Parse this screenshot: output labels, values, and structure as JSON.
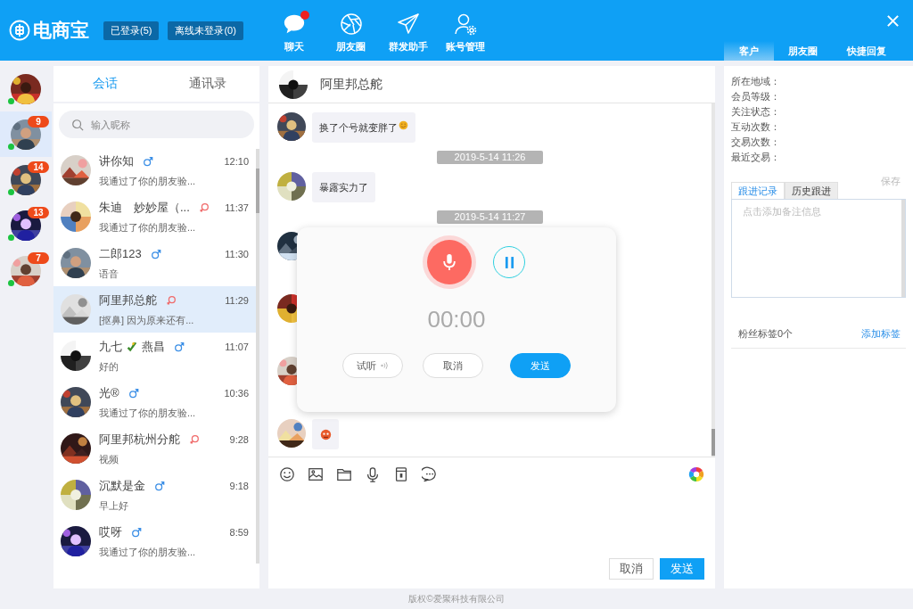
{
  "header": {
    "logo": "电商宝",
    "status_buttons": [
      {
        "label": "已登录(5)"
      },
      {
        "label": "离线未登录(0)"
      }
    ],
    "nav": [
      {
        "label": "聊天",
        "dot": true
      },
      {
        "label": "朋友圈",
        "dot": false
      },
      {
        "label": "群发助手",
        "dot": false
      },
      {
        "label": "账号管理",
        "dot": false
      }
    ],
    "right_tabs": [
      {
        "label": "客户",
        "selected": true
      },
      {
        "label": "朋友圈",
        "selected": false
      },
      {
        "label": "快捷回复",
        "selected": false
      }
    ]
  },
  "accounts": [
    {
      "online": true,
      "selected": false
    },
    {
      "badge": "9",
      "online": true,
      "selected": true
    },
    {
      "badge": "14",
      "online": true,
      "selected": false
    },
    {
      "badge": "13",
      "online": true,
      "selected": false
    },
    {
      "badge": "7",
      "online": true,
      "selected": false
    }
  ],
  "conversations": {
    "tabs": [
      {
        "label": "会话",
        "selected": true
      },
      {
        "label": "通讯录",
        "selected": false
      }
    ],
    "search": {
      "placeholder": "输入昵称"
    },
    "items": [
      {
        "name": "讲你知",
        "kind": "male",
        "time": "12:10",
        "preview": "我通过了你的朋友验...",
        "selected": false
      },
      {
        "name": "朱迪　妙妙屋（...",
        "kind": "female",
        "time": "11:37",
        "preview": "我通过了你的朋友验...",
        "selected": false
      },
      {
        "name": "二郎123",
        "kind": "male",
        "time": "11:30",
        "preview": "语音",
        "selected": false
      },
      {
        "name": "阿里邦总舵",
        "kind": "female",
        "time": "11:29",
        "preview": "[抠鼻] 因为原来还有...",
        "selected": true
      },
      {
        "name": "九七",
        "name_after_icon": "燕昌",
        "kind": "male",
        "time": "11:07",
        "preview": "好的",
        "selected": false
      },
      {
        "name": "光®",
        "kind": "male",
        "time": "10:36",
        "preview": "我通过了你的朋友验...",
        "selected": false
      },
      {
        "name": "阿里邦杭州分舵",
        "kind": "female",
        "time": "9:28",
        "preview": "视频",
        "selected": false
      },
      {
        "name": "沉默是金",
        "kind": "male",
        "time": "9:18",
        "preview": "早上好",
        "selected": false
      },
      {
        "name": "哎呀",
        "kind": "male",
        "time": "8:59",
        "preview": "我通过了你的朋友验...",
        "selected": false
      }
    ]
  },
  "chat": {
    "title": "阿里邦总舵",
    "messages": [
      {
        "kind": "text",
        "text": "换了个号就变胖了",
        "emoji": true
      },
      {
        "kind": "time",
        "text": "2019-5-14 11:26"
      },
      {
        "kind": "text",
        "text": "暴露实力了",
        "emoji": false
      },
      {
        "kind": "time",
        "text": "2019-5-14 11:27"
      },
      {
        "kind": "covered"
      },
      {
        "kind": "covered"
      },
      {
        "kind": "covered"
      },
      {
        "kind": "sticker"
      }
    ],
    "cancel": "取消",
    "send": "发送"
  },
  "recorder": {
    "time": "00:00",
    "buttons": [
      {
        "label": "试听",
        "kind": "listen"
      },
      {
        "label": "取消",
        "kind": "cancel"
      },
      {
        "label": "发送",
        "kind": "send"
      }
    ]
  },
  "customer": {
    "fields": [
      {
        "label": "所在地域："
      },
      {
        "label": "会员等级："
      },
      {
        "label": "关注状态："
      },
      {
        "label": "互动次数："
      },
      {
        "label": "交易次数："
      },
      {
        "label": "最近交易："
      }
    ],
    "follow_tabs": [
      {
        "label": "跟进记录",
        "selected": true
      },
      {
        "label": "历史跟进",
        "selected": false
      }
    ],
    "save": "保存",
    "note_placeholder": "点击添加备注信息",
    "tags_label": "粉丝标签0个",
    "add_tag": "添加标签"
  },
  "footer": "版权©爱聚科技有限公司"
}
